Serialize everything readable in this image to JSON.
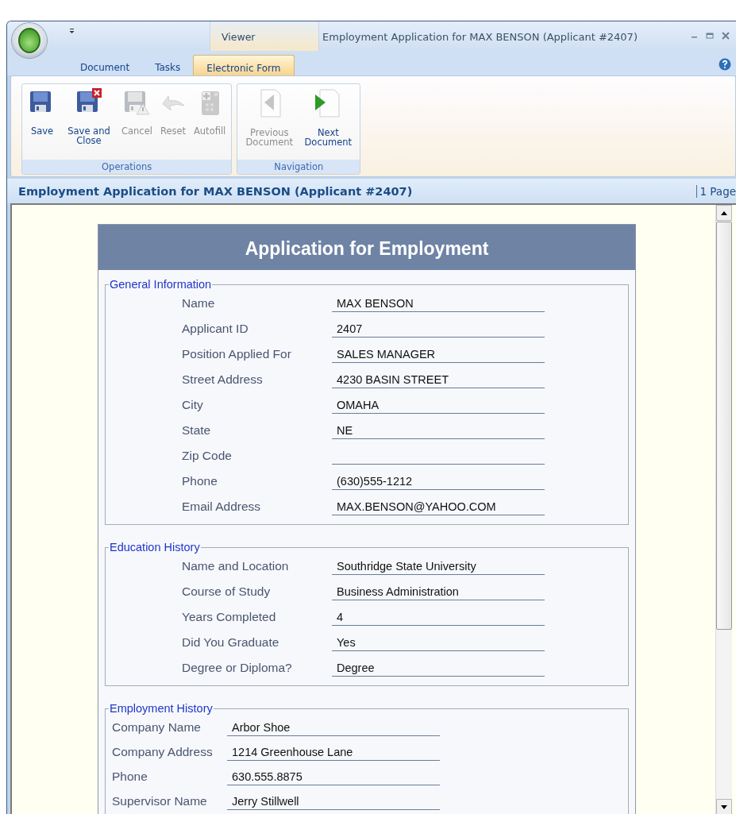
{
  "window": {
    "title": "Employment Application for MAX BENSON (Applicant #2407)",
    "context_group": "Viewer"
  },
  "tabs": [
    {
      "label": "Document",
      "selected": false
    },
    {
      "label": "Tasks",
      "selected": false
    },
    {
      "label": "Electronic Form",
      "selected": true
    }
  ],
  "ribbon_groups": [
    {
      "label": "Operations",
      "buttons": [
        {
          "label": "Save",
          "kind": "save",
          "disabled": false
        },
        {
          "label": "Save and Close",
          "kind": "save_close",
          "disabled": false
        },
        {
          "label": "Cancel",
          "kind": "cancel",
          "disabled": true
        },
        {
          "label": "Reset",
          "kind": "reset",
          "disabled": true
        },
        {
          "label": "Autofill",
          "kind": "autofill",
          "disabled": true
        }
      ]
    },
    {
      "label": "Navigation",
      "buttons": [
        {
          "label": "Previous Document",
          "kind": "previous",
          "disabled": true
        },
        {
          "label": "Next Document",
          "kind": "next",
          "disabled": false
        }
      ]
    }
  ],
  "document_bar": {
    "title": "Employment Application for MAX BENSON (Applicant #2407)",
    "page_count": "1 Page"
  },
  "form": {
    "title": "Application for Employment",
    "sections": [
      {
        "legend": "General Information",
        "kind": "indented",
        "fields": [
          {
            "label": "Name",
            "value": "MAX BENSON"
          },
          {
            "label": "Applicant ID",
            "value": "2407"
          },
          {
            "label": "Position Applied For",
            "value": "SALES MANAGER"
          },
          {
            "label": "Street Address",
            "value": "4230 BASIN STREET"
          },
          {
            "label": "City",
            "value": "OMAHA"
          },
          {
            "label": "State",
            "value": "NE"
          },
          {
            "label": "Zip Code"
          },
          {
            "label": "Phone",
            "value": "(630)555-1212"
          },
          {
            "label": "Email Address",
            "value": "MAX.BENSON@YAHOO.COM"
          }
        ]
      },
      {
        "legend": "Education History",
        "kind": "indented",
        "fields": [
          {
            "label": "Name and Location",
            "value": "Southridge State University"
          },
          {
            "label": "Course of Study",
            "value": "Business Administration"
          },
          {
            "label": "Years Completed",
            "value": "4"
          },
          {
            "label": "Did You Graduate",
            "value": "Yes"
          },
          {
            "label": "Degree or Diploma?",
            "value": "Degree"
          }
        ]
      },
      {
        "legend": "Employment History",
        "kind": "flush",
        "fields": [
          {
            "label": "Company Name",
            "value": "Arbor Shoe"
          },
          {
            "label": "Company Address",
            "value": "1214 Greenhouse Lane"
          },
          {
            "label": "Phone",
            "value": "630.555.8875"
          },
          {
            "label": "Supervisor Name",
            "value": "Jerry Stillwell"
          }
        ]
      }
    ]
  }
}
